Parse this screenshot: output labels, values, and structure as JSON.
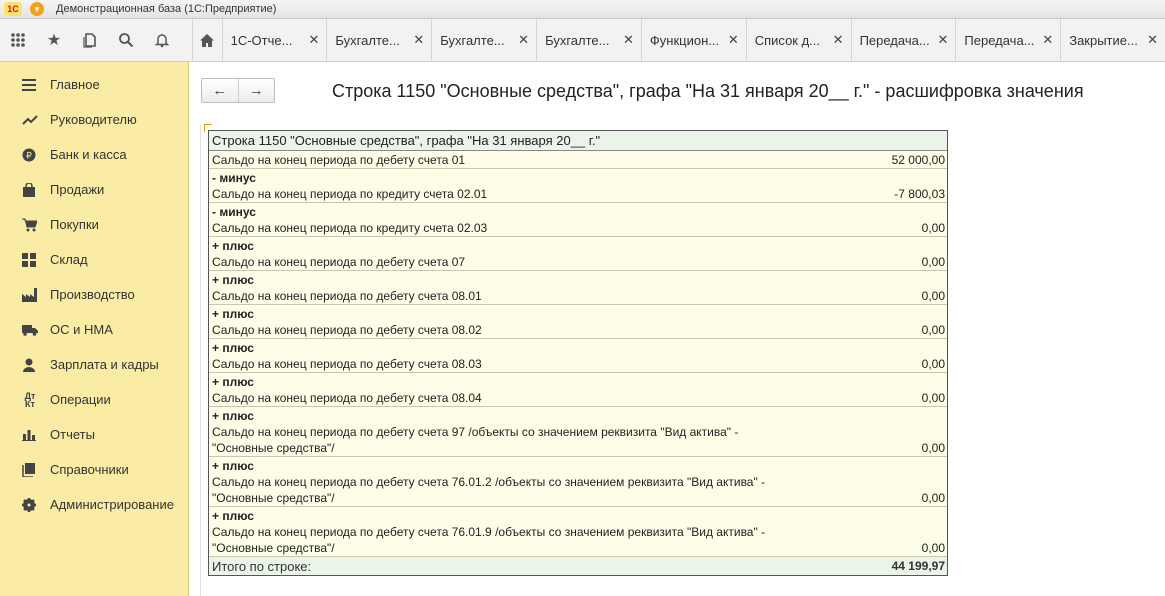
{
  "app": {
    "title": "Демонстрационная база  (1С:Предприятие)",
    "logo": "1С"
  },
  "tabs": [
    {
      "label": "1С-Отче..."
    },
    {
      "label": "Бухгалте..."
    },
    {
      "label": "Бухгалте..."
    },
    {
      "label": "Бухгалте..."
    },
    {
      "label": "Функцион..."
    },
    {
      "label": "Список д..."
    },
    {
      "label": "Передача..."
    },
    {
      "label": "Передача..."
    },
    {
      "label": "Закрытие..."
    }
  ],
  "close_glyph": "✕",
  "sidebar": {
    "items": [
      {
        "label": "Главное",
        "icon": "menu-lines-icon"
      },
      {
        "label": "Руководителю",
        "icon": "trend-icon"
      },
      {
        "label": "Банк и касса",
        "icon": "coin-icon"
      },
      {
        "label": "Продажи",
        "icon": "bag-icon"
      },
      {
        "label": "Покупки",
        "icon": "cart-icon"
      },
      {
        "label": "Склад",
        "icon": "warehouse-icon"
      },
      {
        "label": "Производство",
        "icon": "factory-icon"
      },
      {
        "label": "ОС и НМА",
        "icon": "truck-icon"
      },
      {
        "label": "Зарплата и кадры",
        "icon": "person-icon"
      },
      {
        "label": "Операции",
        "icon": "dt-kt-icon"
      },
      {
        "label": "Отчеты",
        "icon": "bar-chart-icon"
      },
      {
        "label": "Справочники",
        "icon": "book-icon"
      },
      {
        "label": "Администрирование",
        "icon": "gear-icon"
      }
    ]
  },
  "page": {
    "title": "Строка 1150 \"Основные средства\", графа \"На 31 января 20__ г.\" - расшифровка значения",
    "back": "←",
    "forward": "→"
  },
  "report": {
    "header": "Строка 1150 \"Основные средства\", графа \"На 31 января 20__ г.\"",
    "rows": [
      {
        "op": "",
        "lines": [
          "Сальдо на конец периода по дебету счета 01"
        ],
        "value": "52 000,00"
      },
      {
        "op": "- минус",
        "lines": [
          "Сальдо на конец периода по кредиту счета 02.01"
        ],
        "value": "-7 800,03"
      },
      {
        "op": "- минус",
        "lines": [
          "Сальдо на конец периода по кредиту счета 02.03"
        ],
        "value": "0,00"
      },
      {
        "op": "+ плюс",
        "lines": [
          "Сальдо на конец периода по дебету счета 07"
        ],
        "value": "0,00"
      },
      {
        "op": "+ плюс",
        "lines": [
          "Сальдо на конец периода по дебету счета 08.01"
        ],
        "value": "0,00"
      },
      {
        "op": "+ плюс",
        "lines": [
          "Сальдо на конец периода по дебету счета 08.02"
        ],
        "value": "0,00"
      },
      {
        "op": "+ плюс",
        "lines": [
          "Сальдо на конец периода по дебету счета 08.03"
        ],
        "value": "0,00"
      },
      {
        "op": "+ плюс",
        "lines": [
          "Сальдо на конец периода по дебету счета 08.04"
        ],
        "value": "0,00"
      },
      {
        "op": "+ плюс",
        "lines": [
          "Сальдо на конец периода по дебету счета 97 /объекты со значением реквизита \"Вид актива\" -",
          "\"Основные средства\"/"
        ],
        "value": "0,00"
      },
      {
        "op": "+ плюс",
        "lines": [
          "Сальдо на конец периода по дебету счета 76.01.2 /объекты со значением реквизита \"Вид актива\" -",
          "\"Основные средства\"/"
        ],
        "value": "0,00"
      },
      {
        "op": "+ плюс",
        "lines": [
          "Сальдо на конец периода по дебету счета 76.01.9 /объекты со значением реквизита \"Вид актива\" -",
          "\"Основные средства\"/"
        ],
        "value": "0,00"
      }
    ],
    "total": {
      "label": "Итого по строке:",
      "value": "44 199,97"
    }
  }
}
